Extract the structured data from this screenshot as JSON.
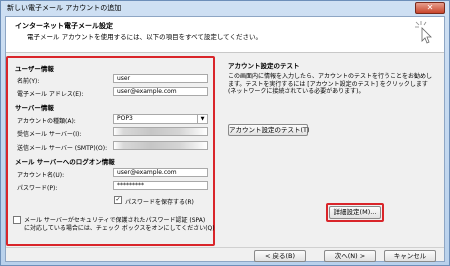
{
  "window": {
    "title": "新しい電子メール アカウントの追加",
    "close_glyph": "✕"
  },
  "header": {
    "title": "インターネット電子メール設定",
    "subtitle": "電子メール アカウントを使用するには、以下の項目をすべて設定してください。"
  },
  "user_info": {
    "heading": "ユーザー情報",
    "name_label": "名前(Y):",
    "name_value": "user",
    "email_label": "電子メール アドレス(E):",
    "email_value": "user@example.com"
  },
  "server_info": {
    "heading": "サーバー情報",
    "account_type_label": "アカウントの種類(A):",
    "account_type_value": "POP3",
    "incoming_label": "受信メール サーバー(I):",
    "outgoing_label": "送信メール サーバー (SMTP)(O):"
  },
  "logon_info": {
    "heading": "メール サーバーへのログオン情報",
    "account_name_label": "アカウント名(U):",
    "account_name_value": "user@example.com",
    "password_label": "パスワード(P):",
    "password_value": "*********",
    "remember_label": "パスワードを保存する(R)",
    "remember_checked": "✓",
    "spa_label_line1": "メール サーバーがセキュリティで保護されたパスワード認証 (SPA)",
    "spa_label_line2": "に対応している場合には、チェック ボックスをオンにしてください(Q)"
  },
  "test": {
    "heading": "アカウント設定のテスト",
    "description": "この画面内に情報を入力したら、アカウントのテストを行うことをお勧めします。テストを実行するには [アカウント設定のテスト] をクリックします (ネットワークに接続されている必要があります)。",
    "test_button": "アカウント設定のテスト(T)",
    "more_settings_button": "詳細設定(M)..."
  },
  "footer": {
    "back_button": "< 戻る(B)",
    "next_button": "次へ(N) >",
    "cancel_button": "キャンセル"
  },
  "colors": {
    "highlight": "#d9252a",
    "accent": "#6d8fb9"
  }
}
